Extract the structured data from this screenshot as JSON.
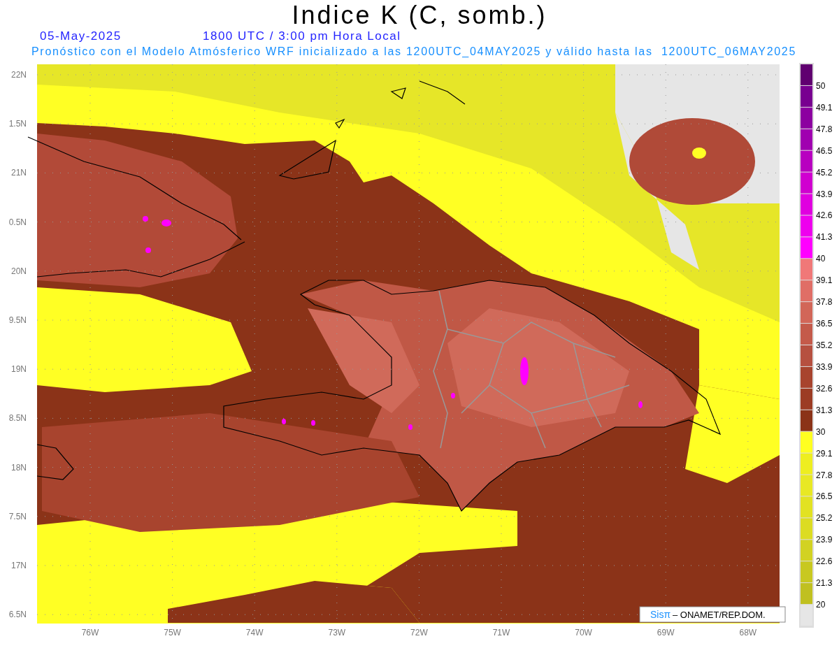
{
  "title": "Indice K (C, somb.)",
  "date": "05-May-2025",
  "time": "1800 UTC / 3:00 pm Hora Local",
  "subtitle": "Pronóstico con el Modelo Atmósferico WRF inicializado a las 1200UTC_04MAY2025 y válido hasta las  1200UTC_06MAY2025",
  "map": {
    "lat_labels": [
      "22N",
      "1.5N",
      "21N",
      "0.5N",
      "20N",
      "9.5N",
      "19N",
      "8.5N",
      "18N",
      "7.5N",
      "17N",
      "6.5N"
    ],
    "lon_labels": [
      "76W",
      "75W",
      "74W",
      "73W",
      "72W",
      "71W",
      "70W",
      "69W",
      "68W"
    ],
    "credit": {
      "logo": "Sisπ",
      "text": "– ONAMET/REP.DOM."
    }
  },
  "legend": {
    "bands": [
      {
        "color": "#600070",
        "label": "50"
      },
      {
        "color": "#780090",
        "label": "49.1"
      },
      {
        "color": "#8c00a0",
        "label": "47.8"
      },
      {
        "color": "#a000b0",
        "label": "46.5"
      },
      {
        "color": "#b800c0",
        "label": "45.2"
      },
      {
        "color": "#d000d0",
        "label": "43.9"
      },
      {
        "color": "#e000e0",
        "label": "42.6"
      },
      {
        "color": "#ee00ee",
        "label": "41.3"
      },
      {
        "color": "#ff00ff",
        "label": "40"
      },
      {
        "color": "#f07878",
        "label": "39.1"
      },
      {
        "color": "#e06e66",
        "label": "37.8"
      },
      {
        "color": "#d26658",
        "label": "36.5"
      },
      {
        "color": "#c45a4a",
        "label": "35.2"
      },
      {
        "color": "#b65040",
        "label": "33.9"
      },
      {
        "color": "#a8442e",
        "label": "32.6"
      },
      {
        "color": "#9c3c24",
        "label": "31.3"
      },
      {
        "color": "#8b3318",
        "label": "30"
      },
      {
        "color": "#ffff20",
        "label": "29.1"
      },
      {
        "color": "#eeee20",
        "label": "27.8"
      },
      {
        "color": "#e8e824",
        "label": "26.5"
      },
      {
        "color": "#e2e222",
        "label": "25.2"
      },
      {
        "color": "#dcdc22",
        "label": "23.9"
      },
      {
        "color": "#d2d222",
        "label": "22.6"
      },
      {
        "color": "#c8c820",
        "label": "21.3"
      },
      {
        "color": "#c0c020",
        "label": "20"
      },
      {
        "color": "#e6e6e6"
      }
    ]
  }
}
